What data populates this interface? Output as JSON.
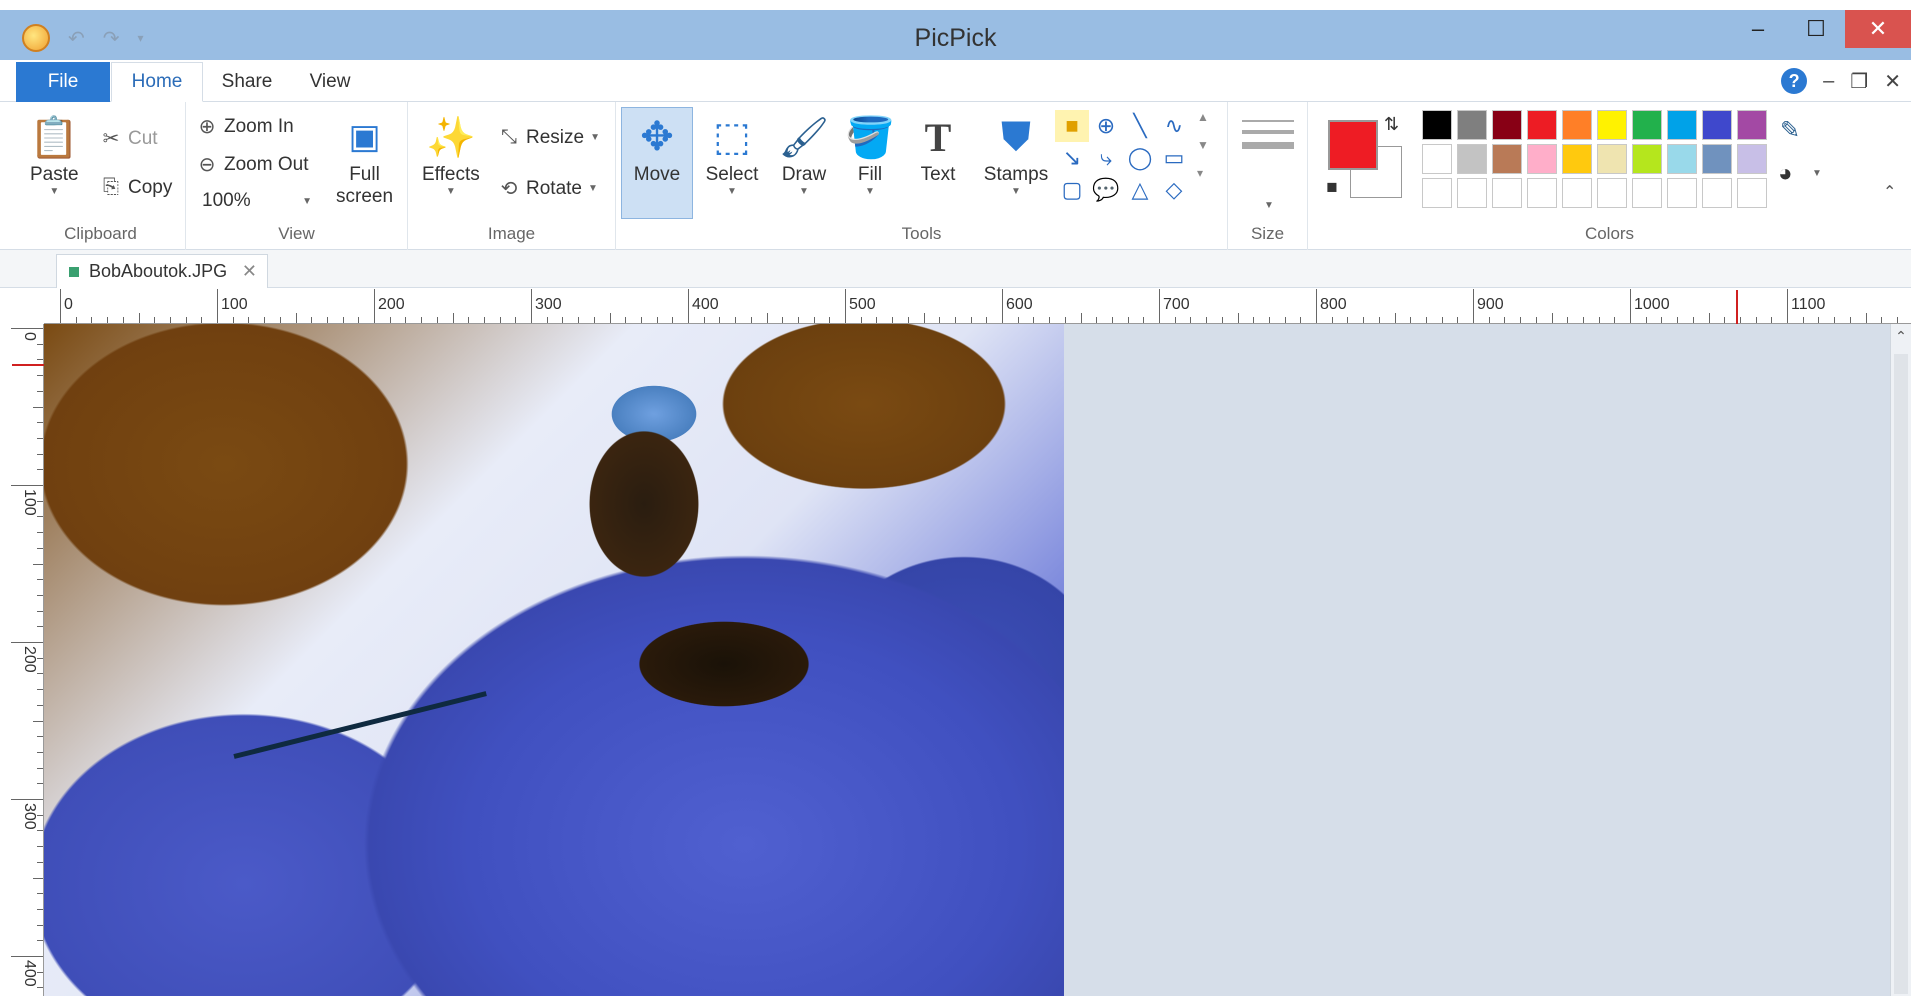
{
  "window": {
    "title": "PicPick"
  },
  "tabs": [
    "File",
    "Home",
    "Share",
    "View"
  ],
  "clipboard": {
    "paste": "Paste",
    "cut": "Cut",
    "copy": "Copy",
    "label": "Clipboard"
  },
  "view": {
    "zoom_in": "Zoom In",
    "zoom_out": "Zoom Out",
    "zoom_level": "100%",
    "full": "Full",
    "screen": "screen",
    "label": "View"
  },
  "image": {
    "effects": "Effects",
    "resize": "Resize",
    "rotate": "Rotate",
    "label": "Image"
  },
  "tools": {
    "move": "Move",
    "select": "Select",
    "draw": "Draw",
    "fill": "Fill",
    "text": "Text",
    "stamps": "Stamps",
    "label": "Tools"
  },
  "size": {
    "label": "Size"
  },
  "colors": {
    "label": "Colors",
    "foreground": "#ee1c24",
    "background": "#ffffff",
    "palette": [
      "#000000",
      "#7f7f7f",
      "#880015",
      "#ed1c24",
      "#ff7f27",
      "#fff200",
      "#22b14c",
      "#00a2e8",
      "#3f48cc",
      "#a349a4",
      "#ffffff",
      "#c3c3c3",
      "#b97a57",
      "#ffaec9",
      "#ffc90e",
      "#efe4b0",
      "#b5e61d",
      "#99d9ea",
      "#7092be",
      "#c8bfe7",
      "#ffffff",
      "#ffffff",
      "#ffffff",
      "#ffffff",
      "#ffffff",
      "#ffffff",
      "#ffffff",
      "#ffffff",
      "#ffffff",
      "#ffffff"
    ]
  },
  "document": {
    "tab_name": "BobAboutok.JPG"
  },
  "ruler": {
    "horizontal": [
      "0",
      "100",
      "200",
      "300",
      "400",
      "500",
      "600",
      "700",
      "800",
      "900",
      "1000",
      "1100"
    ],
    "vertical": [
      "0",
      "100",
      "200",
      "300",
      "400"
    ]
  }
}
